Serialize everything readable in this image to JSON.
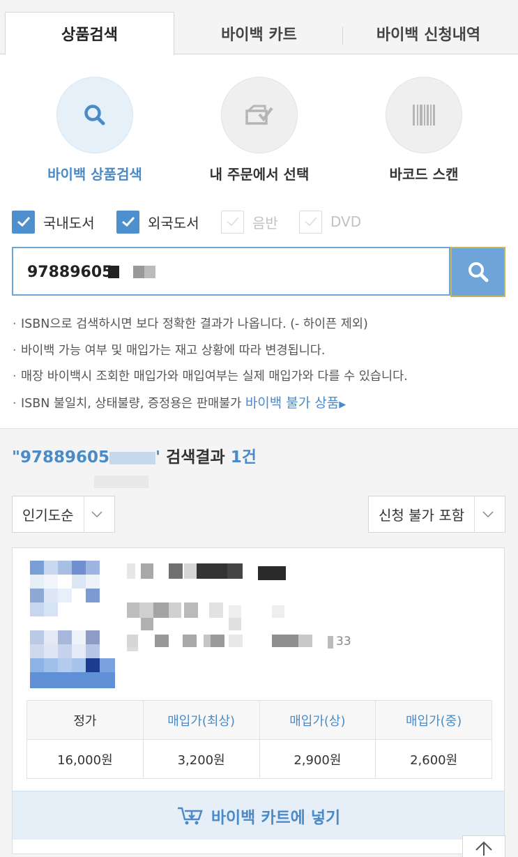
{
  "tabs": [
    {
      "label": "상품검색",
      "active": true
    },
    {
      "label": "바이백 카트",
      "active": false
    },
    {
      "label": "바이백 신청내역",
      "active": false
    }
  ],
  "search_modes": [
    {
      "label": "바이백 상품검색",
      "icon": "search-icon",
      "active": true
    },
    {
      "label": "내 주문에서 선택",
      "icon": "order-check-icon",
      "active": false
    },
    {
      "label": "바코드 스캔",
      "icon": "barcode-icon",
      "active": false
    }
  ],
  "filters": [
    {
      "label": "국내도서",
      "checked": true,
      "enabled": true
    },
    {
      "label": "외국도서",
      "checked": true,
      "enabled": true
    },
    {
      "label": "음반",
      "checked": false,
      "enabled": false
    },
    {
      "label": "DVD",
      "checked": false,
      "enabled": false
    }
  ],
  "search": {
    "value": "97889605",
    "placeholder": ""
  },
  "notices": [
    "ISBN으로 검색하시면 보다 정확한 결과가 나옵니다. (- 하이픈 제외)",
    "바이백 가능 여부 및 매입가는 재고 상황에 따라 변경됩니다.",
    "매장 바이백시 조회한 매입가와 매입여부는 실제 매입가와 다를 수 있습니다.",
    "ISBN 불일치, 상태불량, 증정용은 판매불가"
  ],
  "notice_link": "바이백 불가 상품",
  "results": {
    "query_prefix": "\"97889605",
    "query_suffix": "'",
    "label": " 검색결과 ",
    "count": "1건"
  },
  "sort": {
    "selected": "인기도순"
  },
  "include_filter": {
    "selected": "신청 불가 포함"
  },
  "product": {
    "suffix_fragment": "33",
    "price_table": {
      "headers": [
        "정가",
        "매입가(최상)",
        "매입가(상)",
        "매입가(중)"
      ],
      "values": [
        "16,000원",
        "3,200원",
        "2,900원",
        "2,600원"
      ]
    }
  },
  "cart_button": "바이백 카트에 넣기",
  "colors": {
    "accent": "#4a8bc7",
    "button_blue": "#6ea4d8",
    "check_blue": "#4e8fcd"
  }
}
